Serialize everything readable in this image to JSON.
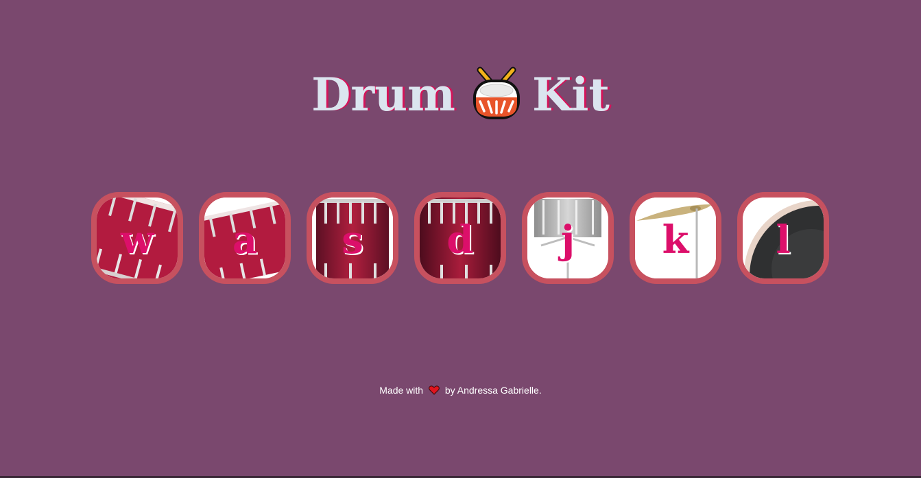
{
  "header": {
    "title_left": "Drum",
    "title_right": "Kit",
    "title_icon": "drum-emoji-icon"
  },
  "drums": [
    {
      "key": "w",
      "image": "crash-tom-icon"
    },
    {
      "key": "a",
      "image": "kick-tom-icon"
    },
    {
      "key": "s",
      "image": "snare-tom-icon"
    },
    {
      "key": "d",
      "image": "floor-tom-icon"
    },
    {
      "key": "j",
      "image": "snare-drum-icon"
    },
    {
      "key": "k",
      "image": "cymbal-icon"
    },
    {
      "key": "l",
      "image": "bass-drum-icon"
    }
  ],
  "footer": {
    "prefix": "Made with",
    "heart_icon": "heart-icon",
    "suffix": "by Andressa Gabrielle."
  },
  "colors": {
    "background": "#7a486e",
    "title": "#dbe5ef",
    "title_shadow": "#d4145a",
    "drum_border": "#c7515f",
    "key_letter": "#dc0f6a"
  }
}
